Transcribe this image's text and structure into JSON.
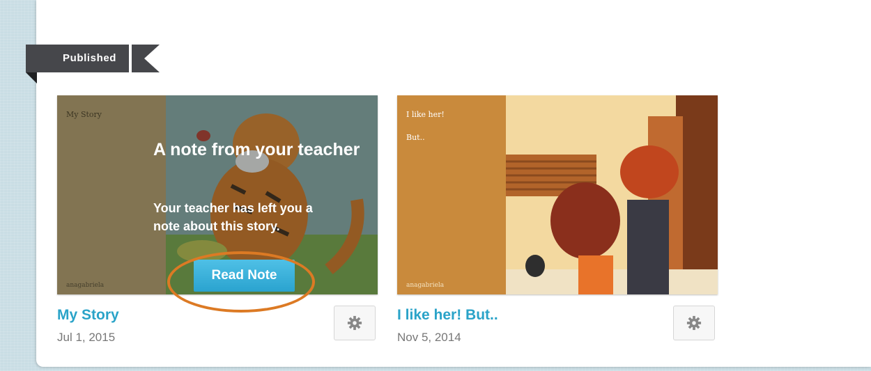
{
  "section": {
    "label": "Published"
  },
  "stories": [
    {
      "title": "My Story",
      "date": "Jul 1, 2015",
      "cover_title": "My Story",
      "cover_author": "anagabriela",
      "note": {
        "heading": "A note from your teacher",
        "body": "Your teacher has left you a note about this story.",
        "button_label": "Read Note"
      },
      "settings_icon": "gear-icon"
    },
    {
      "title": "I like her! But..",
      "date": "Nov 5, 2014",
      "cover_title": "I like her!",
      "cover_subtitle": "But..",
      "cover_author": "anagabriela",
      "settings_icon": "gear-icon"
    }
  ],
  "colors": {
    "accent": "#2aa3c8",
    "button": "#35b0dc",
    "highlight_circle": "#dc7a24",
    "ribbon": "#46474b"
  }
}
